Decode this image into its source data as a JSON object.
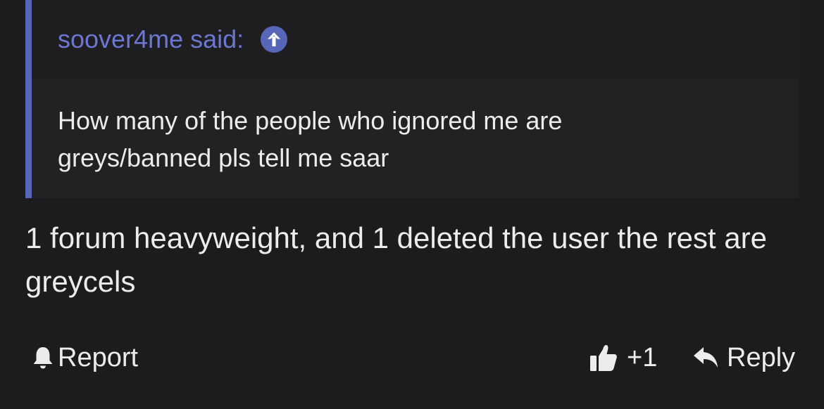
{
  "quote": {
    "author_label": "soover4me said:",
    "text": "How many of the people who ignored me are greys/banned pls tell me saar"
  },
  "message": {
    "text": "1 forum heavyweight, and 1 deleted the user the rest are greycels"
  },
  "actions": {
    "report_label": "Report",
    "reaction_count": "+1",
    "reply_label": "Reply"
  },
  "colors": {
    "accent": "#5866b8",
    "author_link": "#6b77d0",
    "background": "#1c1c1e",
    "quote_background": "#222224",
    "text": "#ececec"
  },
  "icons": {
    "jump_to_quote": "arrow-up-circle-icon",
    "report": "bell-icon",
    "reaction": "thumbs-up-icon",
    "reply": "reply-arrow-icon"
  }
}
